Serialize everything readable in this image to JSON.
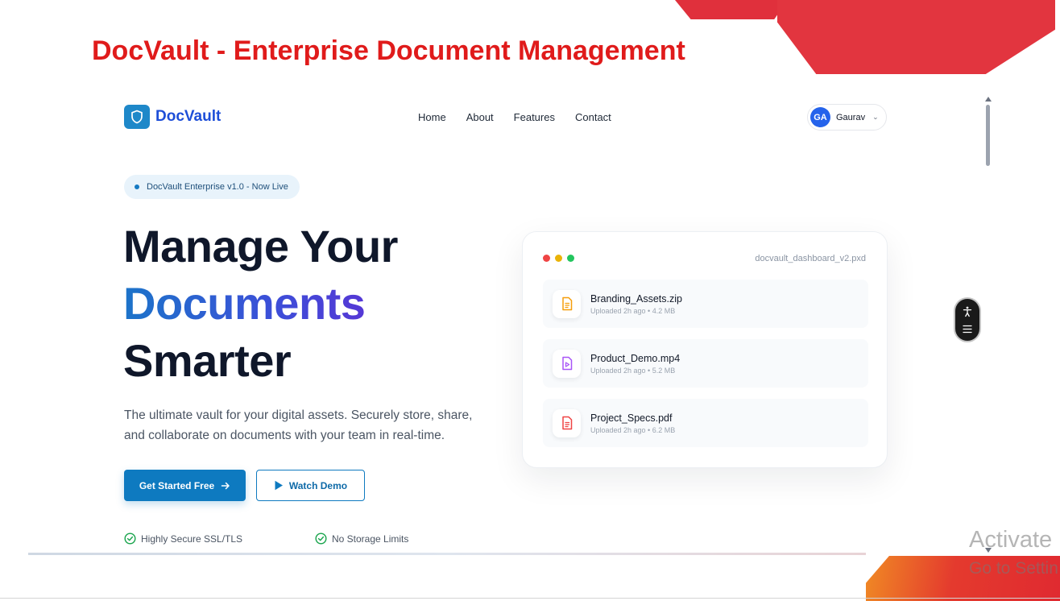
{
  "slide_title": "DocVault - Enterprise Document Management",
  "navbar": {
    "brand": "DocVault",
    "links": [
      "Home",
      "About",
      "Features",
      "Contact"
    ],
    "user": {
      "initials": "GA",
      "name": "Gaurav"
    }
  },
  "hero": {
    "badge": "DocVault Enterprise v1.0 - Now Live",
    "headline_line1": "Manage Your",
    "headline_line2": "Documents",
    "headline_line3": "Smarter",
    "description": "The ultimate vault for your digital assets. Securely store, share, and collaborate on documents with your team in real-time.",
    "primary_cta": "Get Started Free",
    "secondary_cta": "Watch Demo",
    "features": [
      "Highly Secure SSL/TLS",
      "No Storage Limits"
    ]
  },
  "dashboard_card": {
    "filename": "docvault_dashboard_v2.pxd",
    "files": [
      {
        "name": "Branding_Assets.zip",
        "meta": "Uploaded 2h ago • 4.2 MB",
        "icon": "zip-file-icon",
        "color": "#f59e0b"
      },
      {
        "name": "Product_Demo.mp4",
        "meta": "Uploaded 2h ago • 5.2 MB",
        "icon": "video-file-icon",
        "color": "#a855f7"
      },
      {
        "name": "Project_Specs.pdf",
        "meta": "Uploaded 2h ago • 6.2 MB",
        "icon": "pdf-file-icon",
        "color": "#ef4444"
      }
    ]
  },
  "watermark": {
    "line1": "Activate",
    "line2": "Go to Settin"
  },
  "colors": {
    "title_red": "#e01b1b",
    "primary": "#0e7ac0",
    "brand_blue": "#1d4ed8",
    "accent_red": "#e2353f"
  }
}
